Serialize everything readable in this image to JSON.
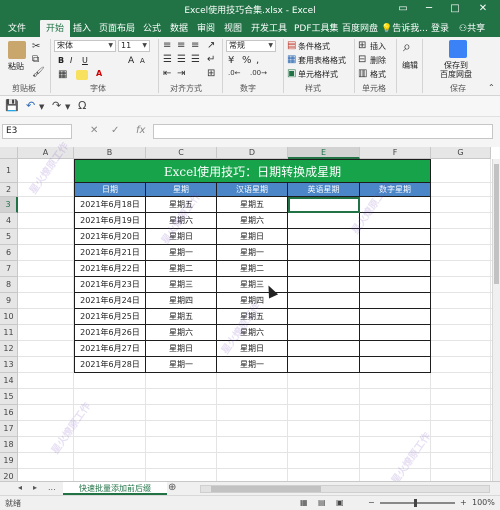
{
  "app": {
    "window_title": "Excel使用技巧合集.xlsx - Excel",
    "accent": "#217346",
    "min_glyph": "─",
    "max_glyph": "□",
    "close_glyph": "✕",
    "ribbon_toggle_glyph": "▭"
  },
  "ribbon_tabs": [
    "文件",
    "开始",
    "插入",
    "页面布局",
    "公式",
    "数据",
    "审阅",
    "视图",
    "开发工具",
    "PDF工具集",
    "百度网盘"
  ],
  "active_tab": "开始",
  "tell_me": "告诉我...",
  "sign_in": "登录",
  "share": "共享",
  "ribbon": {
    "paste_label": "粘贴",
    "clipboard_label": "剪贴板",
    "font_name": "宋体",
    "font_size": "11",
    "bold": "B",
    "italic": "I",
    "underline": "U",
    "font_grow": "A",
    "font_shrink": "A",
    "font_label": "字体",
    "align_label": "对齐方式",
    "number_format": "常规",
    "number_label": "数字",
    "cond_format": "条件格式",
    "table_format": "套用表格格式",
    "cell_style": "单元格样式",
    "styles_label": "样式",
    "insert": "插入",
    "delete": "删除",
    "format": "格式",
    "cells_label": "单元格",
    "edit": "编辑",
    "save_to_baidu_1": "保存到",
    "save_to_baidu_2": "百度网盘",
    "save_label": "保存"
  },
  "icons": {
    "save": "💾",
    "undo": "↶",
    "redo": "↷",
    "omega": "Ω",
    "cancel": "✕",
    "confirm": "✓",
    "percent": "%",
    "comma": ",",
    "search": "⌕",
    "sheet_prev": "◂",
    "sheet_next": "▸",
    "sheet_more": "...",
    "add_sheet": "⊕",
    "normal_view": "▦",
    "page_layout_view": "▤",
    "page_break_view": "▣",
    "zoom_out": "−",
    "zoom_in": "+",
    "dropdown": "▼"
  },
  "formula_bar": {
    "name_box": "E3",
    "fx": "fx",
    "formula": ""
  },
  "grid": {
    "columns": [
      "A",
      "B",
      "C",
      "D",
      "E",
      "F",
      "G"
    ],
    "selected_column": "E",
    "rows": [
      "1",
      "2",
      "3",
      "4",
      "5",
      "6",
      "7",
      "8",
      "9",
      "10",
      "11",
      "12",
      "13",
      "14",
      "15",
      "16",
      "17",
      "18",
      "19",
      "20"
    ],
    "selected_row": "3"
  },
  "table": {
    "title": "Excel使用技巧：日期转换成星期",
    "headers": [
      "日期",
      "星期",
      "汉语星期",
      "英语星期",
      "数字星期"
    ],
    "rows": [
      [
        "2021年6月18日",
        "星期五",
        "星期五",
        "",
        ""
      ],
      [
        "2021年6月19日",
        "星期六",
        "星期六",
        "",
        ""
      ],
      [
        "2021年6月20日",
        "星期日",
        "星期日",
        "",
        ""
      ],
      [
        "2021年6月21日",
        "星期一",
        "星期一",
        "",
        ""
      ],
      [
        "2021年6月22日",
        "星期二",
        "星期二",
        "",
        ""
      ],
      [
        "2021年6月23日",
        "星期三",
        "星期三",
        "",
        ""
      ],
      [
        "2021年6月24日",
        "星期四",
        "星期四",
        "",
        ""
      ],
      [
        "2021年6月25日",
        "星期五",
        "星期五",
        "",
        ""
      ],
      [
        "2021年6月26日",
        "星期六",
        "星期六",
        "",
        ""
      ],
      [
        "2021年6月27日",
        "星期日",
        "星期日",
        "",
        ""
      ],
      [
        "2021年6月28日",
        "星期一",
        "星期一",
        "",
        ""
      ]
    ],
    "title_color": "#16a34a",
    "header_color": "#4a86c8"
  },
  "sheet_tabs": [
    "快速批量添加前后缀"
  ],
  "status": {
    "mode": "就绪",
    "zoom": "100%"
  },
  "watermark_text": "星火燎原工作"
}
